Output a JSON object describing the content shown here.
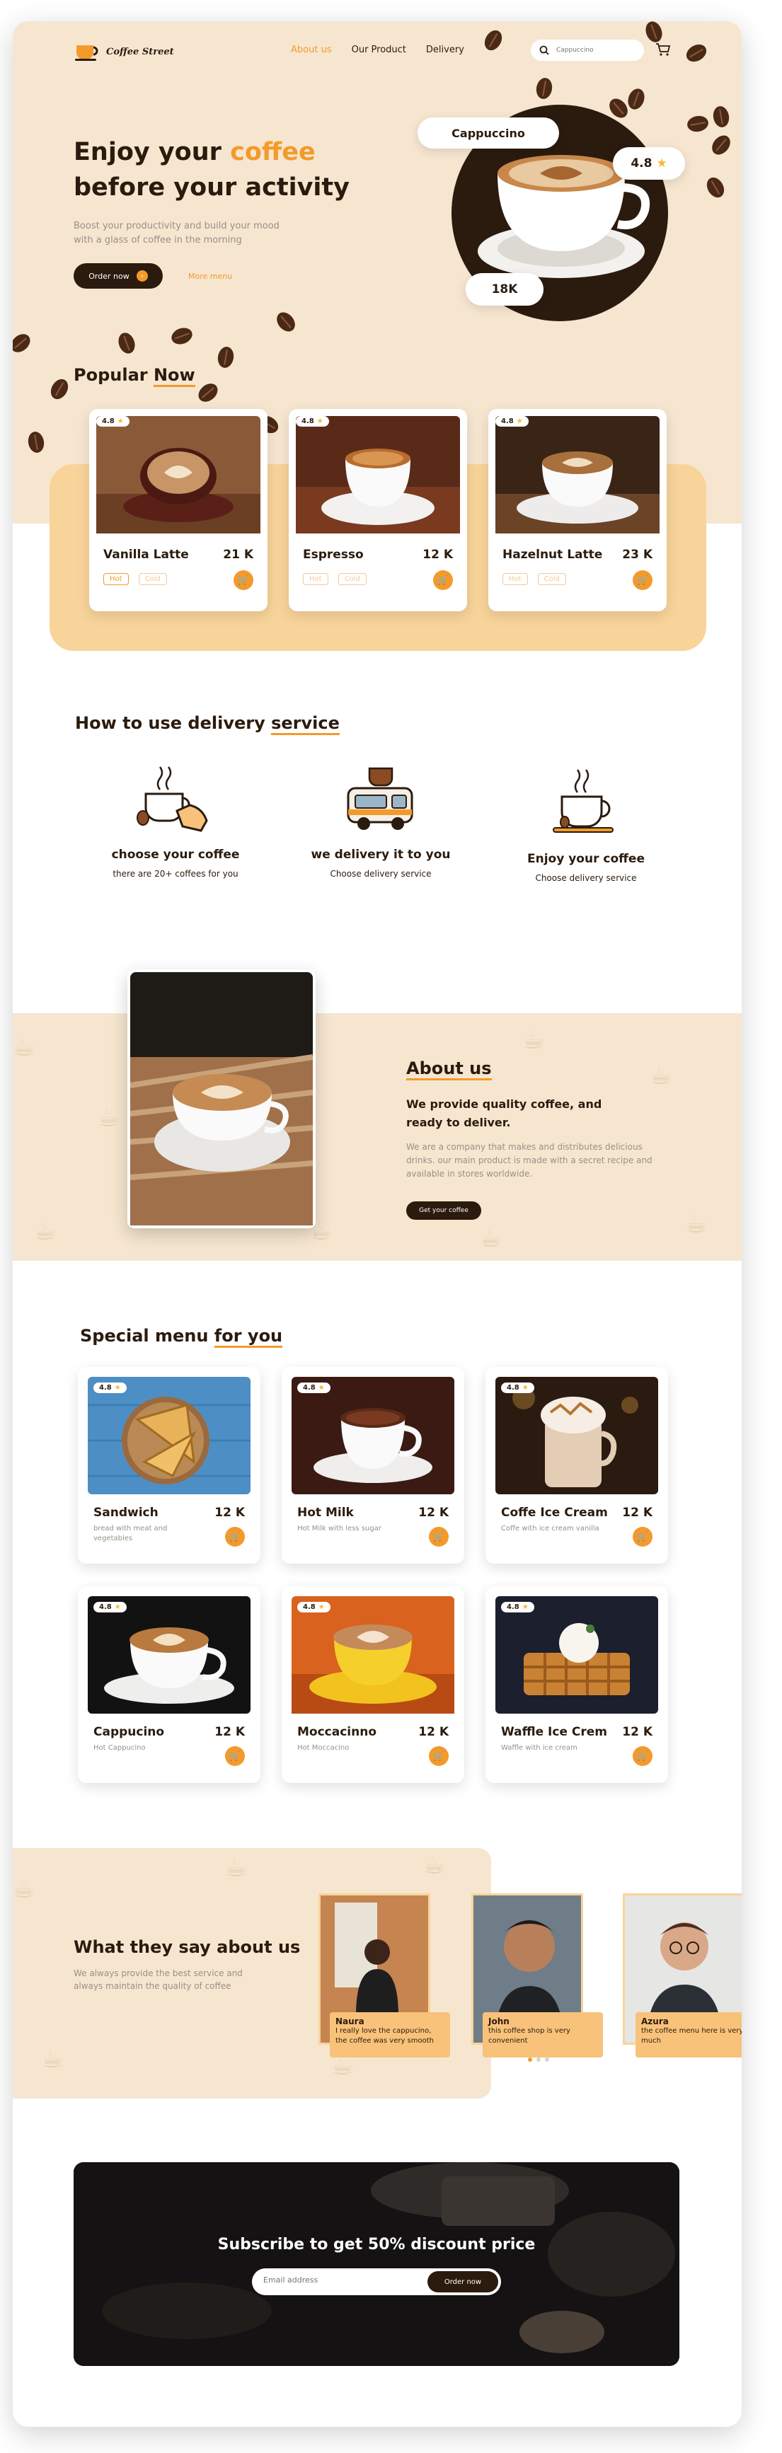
{
  "nav": {
    "logo_text": "Coffee Street",
    "links": [
      "About us",
      "Our Product",
      "Delivery"
    ],
    "search_placeholder": "Cappuccino"
  },
  "hero": {
    "title_line1": "Enjoy your",
    "title_accent": "coffee",
    "title_line2": "before your activity",
    "subtitle": "Boost your productivity and build your mood with a glass of coffee in the morning",
    "order_button": "Order now",
    "more_link": "More menu",
    "product_label": "Cappuccino",
    "rating": "4.8",
    "count": "18K"
  },
  "popular": {
    "title_plain": "Popular",
    "title_accent": "Now",
    "items": [
      {
        "name": "Vanilla Latte",
        "price": "21 K",
        "rating": "4.8",
        "tags": [
          "Hot",
          "Cold"
        ]
      },
      {
        "name": "Espresso",
        "price": "12 K",
        "rating": "4.8",
        "tags": [
          "Hot",
          "Cold"
        ]
      },
      {
        "name": "Hazelnut Latte",
        "price": "23 K",
        "rating": "4.8",
        "tags": [
          "Hot",
          "Cold"
        ]
      }
    ]
  },
  "delivery": {
    "title_plain": "How to use delivery",
    "title_accent": "service",
    "steps": [
      {
        "title": "choose your coffee",
        "desc": "there are 20+ coffees for you"
      },
      {
        "title": "we delivery it to you",
        "desc": "Choose delivery service"
      },
      {
        "title": "Enjoy your coffee",
        "desc": "Choose delivery service"
      }
    ]
  },
  "about": {
    "title": "About us",
    "headline": "We provide quality coffee, and ready to deliver.",
    "body": "We are a company that makes and distributes delicious drinks. our main product is made with a secret recipe and available in stores worldwide.",
    "button": "Get your coffee"
  },
  "special": {
    "title_plain": "Special menu",
    "title_accent": "for you",
    "items": [
      {
        "name": "Sandwich",
        "price": "12 K",
        "rating": "4.8",
        "desc": "bread with meat and vegetables"
      },
      {
        "name": "Hot Milk",
        "price": "12 K",
        "rating": "4.8",
        "desc": "Hot Milk with less sugar"
      },
      {
        "name": "Coffe Ice Cream",
        "price": "12 K",
        "rating": "4.8",
        "desc": "Coffe with ice cream vanilla"
      },
      {
        "name": "Cappucino",
        "price": "12 K",
        "rating": "4.8",
        "desc": "Hot Cappucino"
      },
      {
        "name": "Moccacinno",
        "price": "12 K",
        "rating": "4.8",
        "desc": "Hot Moccacino"
      },
      {
        "name": "Waffle Ice Crem",
        "price": "12 K",
        "rating": "4.8",
        "desc": "Waffle with ice cream"
      }
    ]
  },
  "testimonials": {
    "title": "What they say about us",
    "subtitle": "We always provide the best service and always maintain the quality of coffee",
    "items": [
      {
        "name": "Naura",
        "quote": "I really love the cappucino, the coffee was very smooth"
      },
      {
        "name": "John",
        "quote": "this coffee shop is very convenient"
      },
      {
        "name": "Azura",
        "quote": "the coffee menu here is very much"
      }
    ]
  },
  "subscribe": {
    "title": "Subscribe to get 50% discount price",
    "placeholder": "Email address",
    "button": "Order now"
  },
  "colors": {
    "accent": "#f39a2b",
    "dark": "#2b1b0e",
    "cream": "#f6e6d0"
  }
}
